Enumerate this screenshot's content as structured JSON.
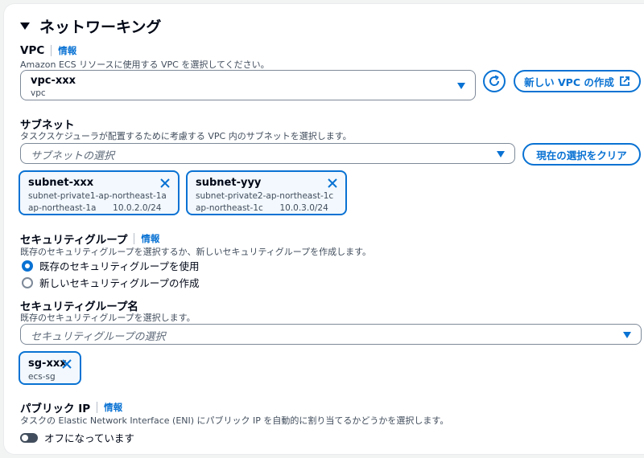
{
  "section": {
    "title": "ネットワーキング"
  },
  "vpc": {
    "label": "VPC",
    "info": "情報",
    "description": "Amazon ECS リソースに使用する VPC を選択してください。",
    "selected_value": "vpc-xxx",
    "selected_sub": "vpc",
    "create_button": "新しい VPC の作成"
  },
  "subnet": {
    "label": "サブネット",
    "description": "タスクスケジューラが配置するために考慮する VPC 内のサブネットを選択します。",
    "placeholder": "サブネットの選択",
    "clear_button": "現在の選択をクリア",
    "tokens": [
      {
        "name": "subnet-xxx",
        "detail": "subnet-private1-ap-northeast-1a",
        "az": "ap-northeast-1a",
        "cidr": "10.0.2.0/24"
      },
      {
        "name": "subnet-yyy",
        "detail": "subnet-private2-ap-northeast-1c",
        "az": "ap-northeast-1c",
        "cidr": "10.0.3.0/24"
      }
    ]
  },
  "security_group": {
    "label": "セキュリティグループ",
    "info": "情報",
    "description": "既存のセキュリティグループを選択するか、新しいセキュリティグループを作成します。",
    "option_existing": "既存のセキュリティグループを使用",
    "option_new": "新しいセキュリティグループの作成",
    "selected_option": "existing"
  },
  "security_group_name": {
    "label": "セキュリティグループ名",
    "description": "既存のセキュリティグループを選択します。",
    "placeholder": "セキュリティグループの選択",
    "tokens": [
      {
        "name": "sg-xxx",
        "detail": "ecs-sg"
      }
    ]
  },
  "public_ip": {
    "label": "パブリック IP",
    "info": "情報",
    "description": "タスクの Elastic Network Interface (ENI) にパブリック IP を自動的に割り当てるかどうかを選択します。",
    "toggle_label": "オフになっています",
    "enabled": false
  },
  "colors": {
    "accent": "#0972d3",
    "text": "#000716",
    "muted": "#414d5c",
    "token_bg": "#f2f8fd"
  }
}
